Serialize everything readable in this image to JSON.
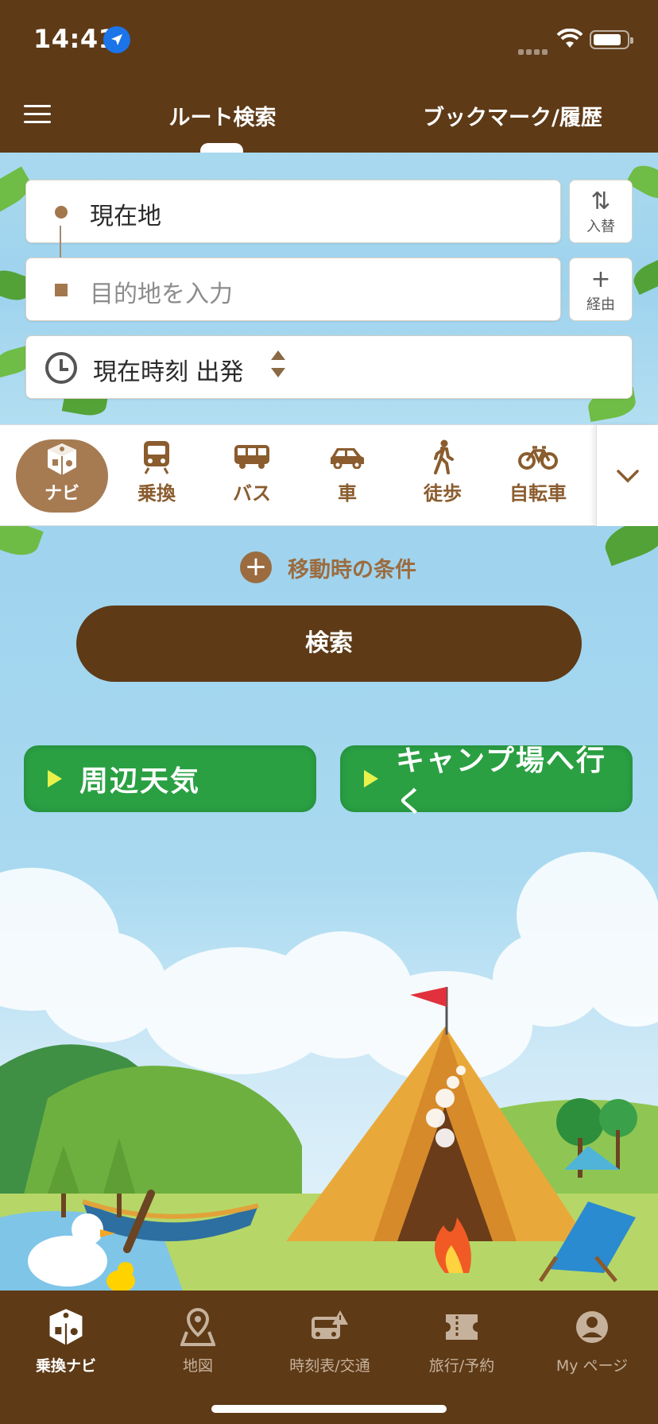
{
  "status": {
    "time": "14:41"
  },
  "header": {
    "tab_route": "ルート検索",
    "tab_bookmark": "ブックマーク/履歴"
  },
  "search": {
    "from_value": "現在地",
    "to_placeholder": "目的地を入力",
    "swap_label": "入替",
    "via_label": "経由",
    "time_label": "現在時刻 出発"
  },
  "modes": [
    {
      "label": "ナビ",
      "icon": "navi-icon",
      "active": true
    },
    {
      "label": "乗換",
      "icon": "train-icon"
    },
    {
      "label": "バス",
      "icon": "bus-icon"
    },
    {
      "label": "車",
      "icon": "car-icon"
    },
    {
      "label": "徒歩",
      "icon": "walk-icon"
    },
    {
      "label": "自転車",
      "icon": "bicycle-icon"
    }
  ],
  "main": {
    "conditions_label": "移動時の条件",
    "search_button": "検索",
    "weather_button": "周辺天気",
    "camp_button": "キャンプ場へ行く"
  },
  "bottom_nav": [
    {
      "label": "乗換ナビ",
      "icon": "navi-icon",
      "active": true
    },
    {
      "label": "地図",
      "icon": "map-pin-icon"
    },
    {
      "label": "時刻表/交通",
      "icon": "bus-alert-icon"
    },
    {
      "label": "旅行/予約",
      "icon": "ticket-icon"
    },
    {
      "label": "My ページ",
      "icon": "user-icon"
    }
  ],
  "colors": {
    "brand_brown": "#5e3a17",
    "accent_brown": "#a67b52",
    "green_button": "#2aa043",
    "sky": "#9fd3ee"
  }
}
